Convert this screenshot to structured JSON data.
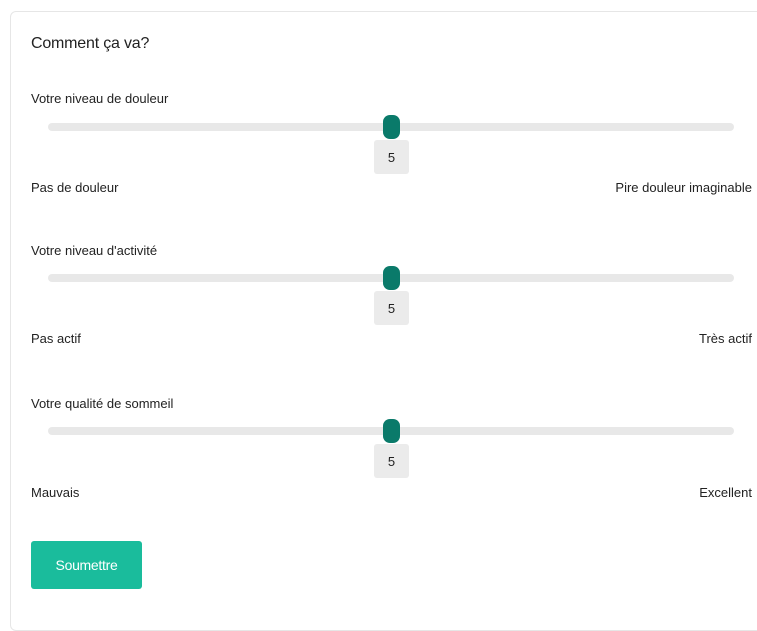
{
  "form": {
    "title": "Comment ça va?",
    "submit_label": "Soumettre"
  },
  "sliders": [
    {
      "label": "Votre niveau de douleur",
      "value": 5,
      "value_text": "5",
      "min_label": "Pas de douleur",
      "max_label": "Pire douleur imaginable"
    },
    {
      "label": "Votre niveau d'activité",
      "value": 5,
      "value_text": "5",
      "min_label": "Pas actif",
      "max_label": "Très actif"
    },
    {
      "label": "Votre qualité de sommeil",
      "value": 5,
      "value_text": "5",
      "min_label": "Mauvais",
      "max_label": "Excellent"
    }
  ],
  "colors": {
    "thumb": "#0a7a6a",
    "submit": "#1abc9c"
  }
}
